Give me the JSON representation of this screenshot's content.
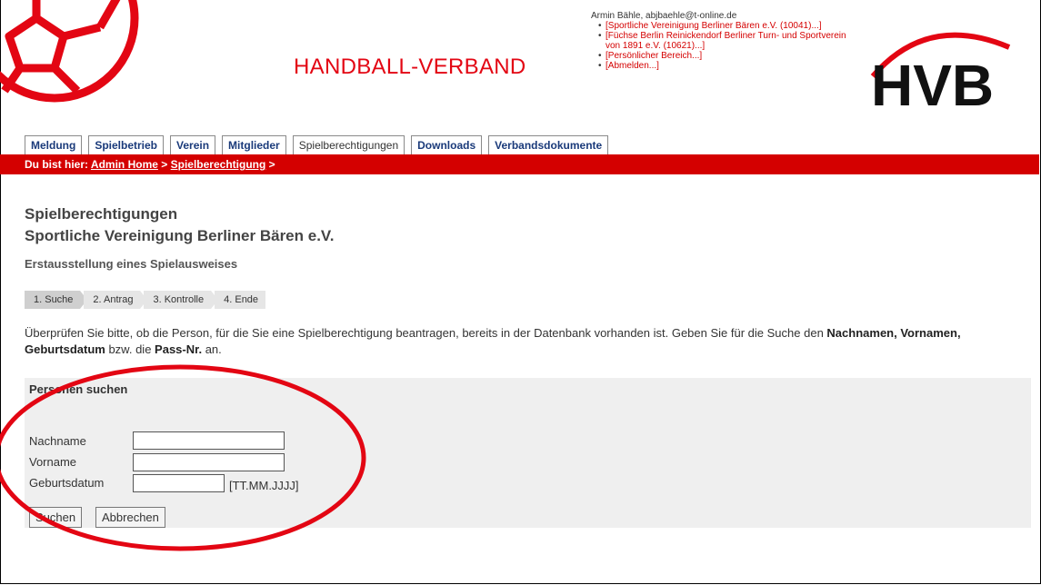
{
  "header": {
    "brand_title": "HANDBALL-VERBAND",
    "logo_text": "HVB",
    "user_name": "Armin Bähle, abjbaehle@t-online.de",
    "user_links": [
      "[Sportliche Vereinigung Berliner Bären e.V. (10041)...]",
      "[Füchse Berlin Reinickendorf Berliner Turn- und Sportverein von 1891 e.V. (10621)...]",
      "[Persönlicher Bereich...]",
      "[Abmelden...]"
    ]
  },
  "tabs": [
    {
      "label": "Meldung"
    },
    {
      "label": "Spielbetrieb"
    },
    {
      "label": "Verein"
    },
    {
      "label": "Mitglieder"
    },
    {
      "label": "Spielberechtigungen",
      "active": true
    },
    {
      "label": "Downloads"
    },
    {
      "label": "Verbandsdokumente"
    }
  ],
  "breadcrumb": {
    "prefix": "Du bist hier:",
    "home": "Admin Home",
    "sep1": ">",
    "current": "Spielberechtigung",
    "sep2": ">"
  },
  "main": {
    "title": "Spielberechtigungen",
    "club": "Sportliche Vereinigung Berliner Bären e.V.",
    "subtitle": "Erstausstellung eines Spielausweises",
    "steps": [
      "1.  Suche",
      "2.  Antrag",
      "3.  Kontrolle",
      "4.  Ende"
    ],
    "description_pre": "Überprüfen Sie bitte, ob die Person, für die Sie eine Spielberechtigung beantragen, bereits in der Datenbank vorhanden ist. Geben Sie für die Suche den ",
    "description_b1": "Nachnamen, Vornamen, Geburtsdatum",
    "description_mid": " bzw. die ",
    "description_b2": "Pass-Nr.",
    "description_post": " an."
  },
  "search": {
    "panel_title": "Personen suchen",
    "label_lastname": "Nachname",
    "label_firstname": "Vorname",
    "label_birthdate": "Geburtsdatum",
    "value_lastname": "",
    "value_firstname": "",
    "value_birthdate": "",
    "date_hint": "[TT.MM.JJJJ]",
    "search_button": "Suchen",
    "cancel_button": "Abbrechen"
  },
  "colors": {
    "accent_red": "#d40000",
    "brand_red": "#e30613",
    "tab_text": "#1a3a7a",
    "panel_bg": "#efefef"
  }
}
